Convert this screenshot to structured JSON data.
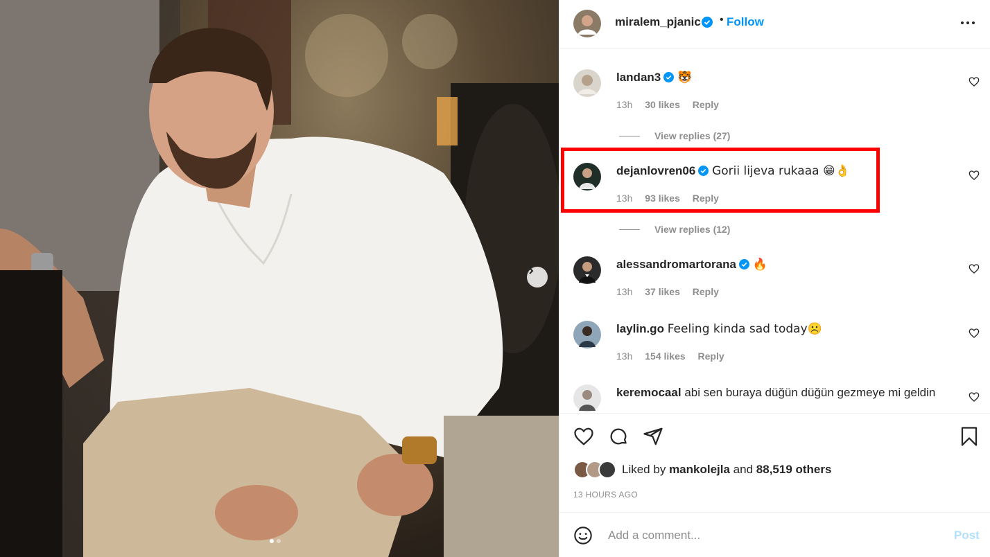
{
  "post": {
    "username": "miralem_pjanic",
    "verified": true,
    "separator": "•",
    "follow_label": "Follow",
    "more_icon": "more-horizontal-icon"
  },
  "photo": {
    "description_icon": "post-photo",
    "carousel_pages": 2,
    "carousel_active": 1
  },
  "comments": [
    {
      "username": "landan3",
      "verified": true,
      "text": "🐯",
      "time": "13h",
      "likes": "30 likes",
      "reply_label": "Reply",
      "view_replies": "View replies (27)"
    },
    {
      "username": "dejanlovren06",
      "verified": true,
      "text": "Gorii lijeva rukaaa 😁👌",
      "time": "13h",
      "likes": "93 likes",
      "reply_label": "Reply",
      "view_replies": "View replies (12)",
      "highlighted": true
    },
    {
      "username": "alessandromartorana",
      "verified": true,
      "text": "🔥",
      "time": "13h",
      "likes": "37 likes",
      "reply_label": "Reply"
    },
    {
      "username": "laylin.go",
      "verified": false,
      "text": "Feeling kinda sad today☹️",
      "time": "13h",
      "likes": "154 likes",
      "reply_label": "Reply"
    },
    {
      "username": "keremocaal",
      "verified": false,
      "text": "abi sen buraya düğün düğün gezmeye mi geldin"
    }
  ],
  "likes": {
    "prefix": "Liked by",
    "user": "mankolejla",
    "connector": "and",
    "others": "88,519 others"
  },
  "timestamp": "13 HOURS AGO",
  "composer": {
    "placeholder": "Add a comment...",
    "post_label": "Post"
  },
  "colors": {
    "accent": "#0095f6",
    "highlight": "#ff0000",
    "muted": "#8e8e8e",
    "post_disabled": "#b2dffc"
  }
}
